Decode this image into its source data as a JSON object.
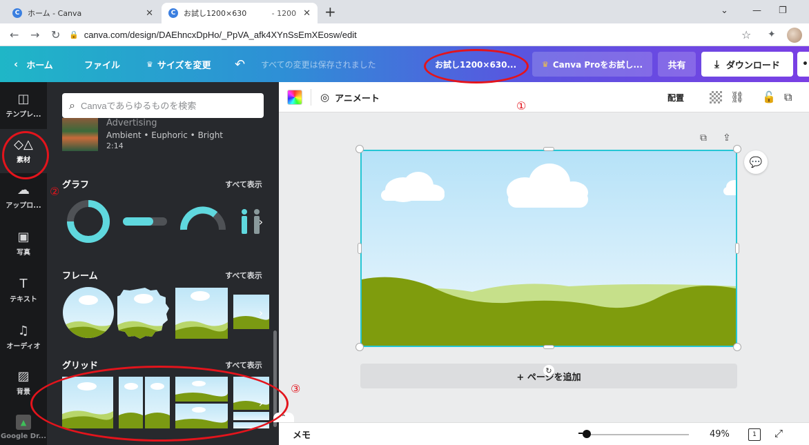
{
  "browser": {
    "tabs": [
      {
        "title": "ホーム - Canva",
        "active": false
      },
      {
        "title": "お試し1200×630",
        "suffix": "- 1200",
        "active": true
      }
    ],
    "url": "canva.com/design/DAEhncxDpHo/_PpVA_afk4XYnSsEmXEosw/edit"
  },
  "topbar": {
    "home": "ホーム",
    "file": "ファイル",
    "resize": "サイズを変更",
    "saved_status": "すべての変更は保存されました",
    "doc_title": "お試し1200×630...",
    "pro_button": "Canva Proをお試し...",
    "share": "共有",
    "download": "ダウンロード",
    "more": "• •"
  },
  "rail": [
    {
      "label": "テンプレ...",
      "icon": "template-icon"
    },
    {
      "label": "素材",
      "icon": "elements-icon",
      "active": true
    },
    {
      "label": "アップロ...",
      "icon": "upload-icon"
    },
    {
      "label": "写真",
      "icon": "photo-icon"
    },
    {
      "label": "テキスト",
      "icon": "text-icon"
    },
    {
      "label": "オーディオ",
      "icon": "audio-icon"
    },
    {
      "label": "背景",
      "icon": "background-icon"
    },
    {
      "label": "Google Dr...",
      "icon": "google-drive-icon"
    }
  ],
  "panel": {
    "search_placeholder": "Canvaであらゆるものを検索",
    "audio": {
      "title": "Advertising",
      "tags": "Ambient • Euphoric • Bright",
      "duration": "2:14"
    },
    "sections": [
      {
        "title": "グラフ",
        "see_all": "すべて表示"
      },
      {
        "title": "フレーム",
        "see_all": "すべて表示"
      },
      {
        "title": "グリッド",
        "see_all": "すべて表示"
      }
    ]
  },
  "toolbar": {
    "animate": "アニメート",
    "arrange": "配置"
  },
  "canvas": {
    "add_page": "+ ページを追加"
  },
  "bottombar": {
    "memo": "メモ",
    "zoom": "49%",
    "page_count": "1"
  },
  "annotations": [
    "①",
    "②",
    "③"
  ],
  "colors": {
    "accent": "#25c6d4",
    "annotation": "#e3141c",
    "panel_bg": "#27292d",
    "rail_bg": "#18191b"
  }
}
